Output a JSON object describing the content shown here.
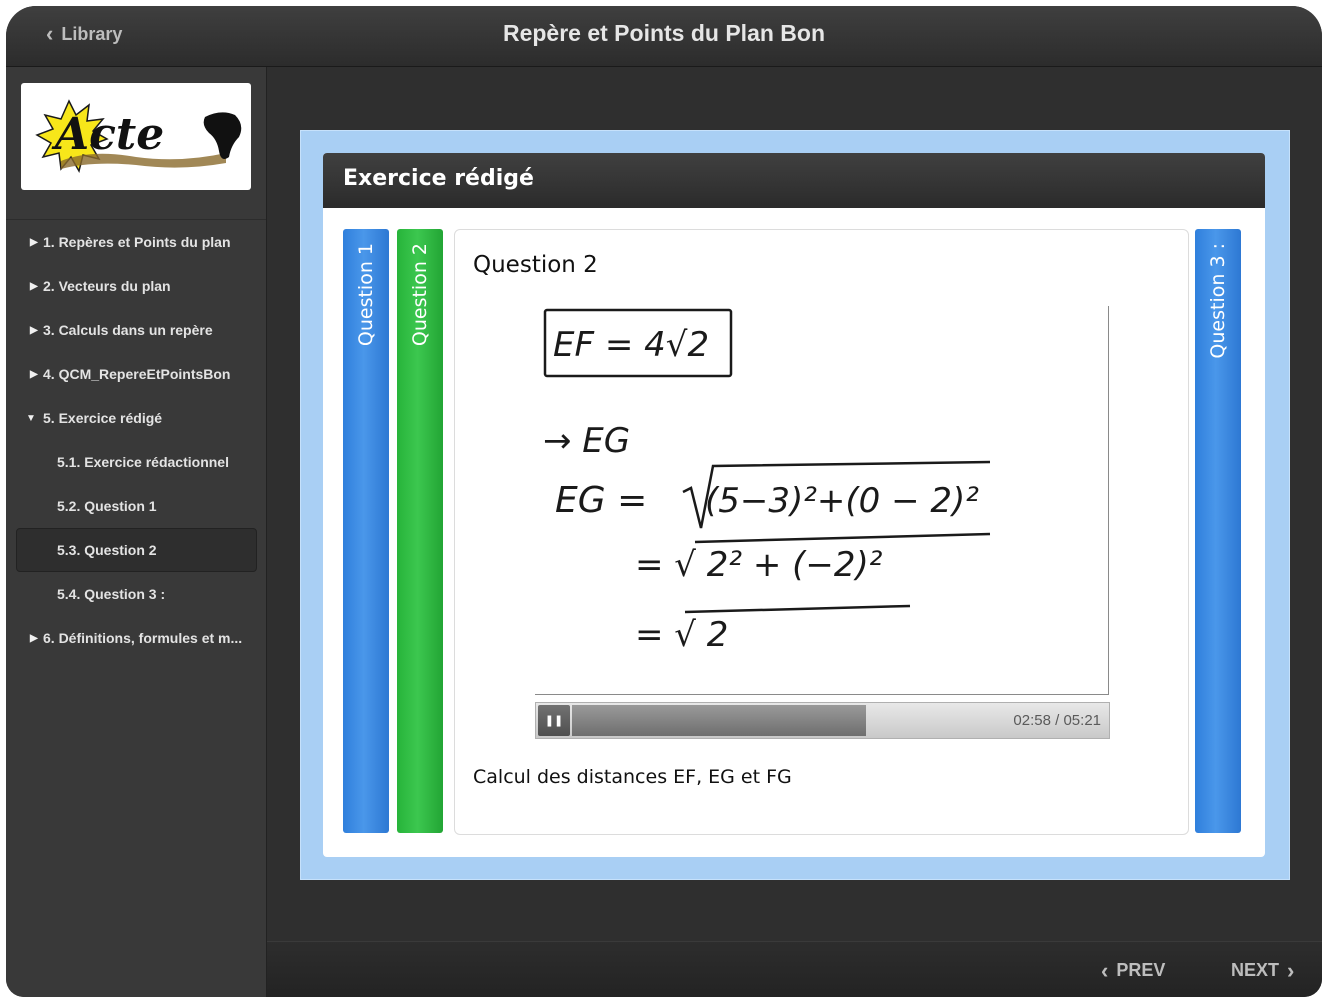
{
  "titlebar": {
    "back_label": "Library",
    "title": "Repère et Points du Plan Bon"
  },
  "sidebar": {
    "logo_text": "Acte",
    "items": [
      {
        "label": "1. Repères et Points du plan",
        "level": 1,
        "expanded": false
      },
      {
        "label": "2. Vecteurs du plan",
        "level": 1,
        "expanded": false
      },
      {
        "label": "3. Calculs dans un repère",
        "level": 1,
        "expanded": false
      },
      {
        "label": "4. QCM_RepereEtPointsBon",
        "level": 1,
        "expanded": false
      },
      {
        "label": "5. Exercice rédigé",
        "level": 1,
        "expanded": true
      },
      {
        "label": "5.1. Exercice rédactionnel",
        "level": 2
      },
      {
        "label": "5.2. Question 1",
        "level": 2
      },
      {
        "label": "5.3. Question 2",
        "level": 2,
        "active": true
      },
      {
        "label": "5.4. Question 3 :",
        "level": 2
      },
      {
        "label": "6. Définitions, formules et m...",
        "level": 1,
        "expanded": false
      }
    ]
  },
  "panel": {
    "title": "Exercice rédigé",
    "tabs": [
      {
        "label": "Question 1",
        "color": "#3b8be6"
      },
      {
        "label": "Question 2",
        "color": "#2ebd42"
      },
      {
        "label": "Question 3 :",
        "color": "#3b8be6"
      }
    ],
    "content": {
      "title": "Question 2",
      "whiteboard": {
        "line1": "EF = 4√2",
        "line2": "→ EG",
        "line3_lhs": "EG =",
        "line3_rad": "(5−3)²+(0 − 2)²",
        "line4": "= √ 2² + (−2)²",
        "line5": "= √ 2"
      },
      "player": {
        "progress_percent": 55,
        "time_text": "02:58 / 05:21"
      },
      "caption": "Calcul des distances EF, EG et FG"
    }
  },
  "footer": {
    "prev_label": "PREV",
    "next_label": "NEXT"
  }
}
